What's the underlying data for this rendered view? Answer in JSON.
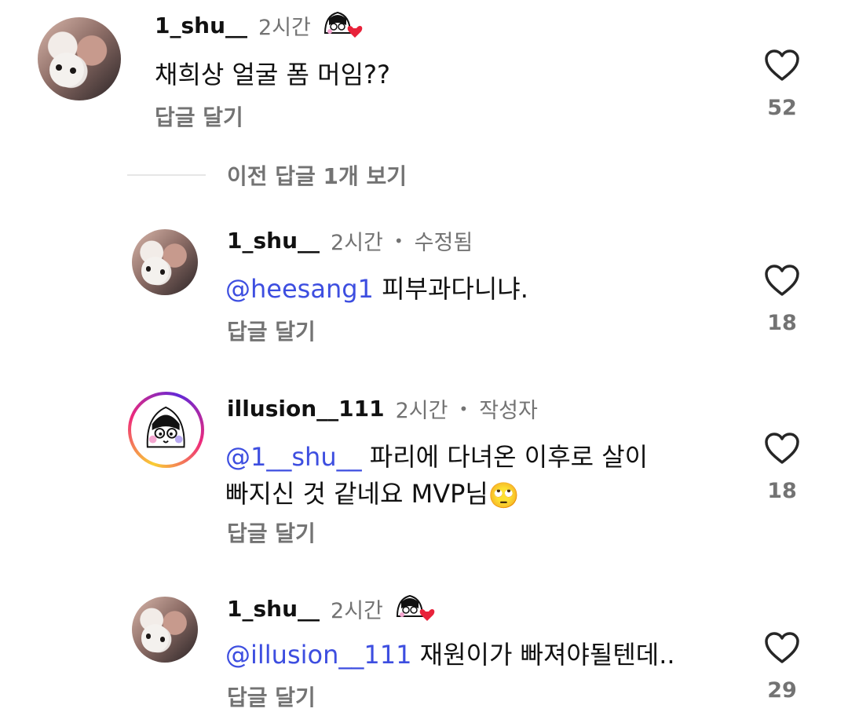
{
  "comments": [
    {
      "username": "1_shu__",
      "time": "2시간",
      "text": "채희상 얼굴 폼 머임??",
      "reply_label": "답글 달기",
      "likes": "52"
    }
  ],
  "view_previous": "이전 답글 1개 보기",
  "replies": [
    {
      "username": "1_shu__",
      "time": "2시간",
      "separator": "•",
      "tag": "수정됨",
      "mention": "@heesang1",
      "text": " 피부과다니냐.",
      "reply_label": "답글 달기",
      "likes": "18"
    },
    {
      "username": "illusion__111",
      "time": "2시간",
      "separator": "•",
      "tag": "작성자",
      "mention": "@1__shu__",
      "text_line1": " 파리에 다녀온 이후로 살이",
      "text_line2": "빠지신 것 같네요 MVP님",
      "emoji": "🙄",
      "reply_label": "답글 달기",
      "likes": "18"
    },
    {
      "username": "1_shu__",
      "time": "2시간",
      "mention": "@illusion__111",
      "text": " 재원이가 빠져야될텐데..",
      "reply_label": "답글 달기",
      "likes": "29"
    }
  ],
  "colors": {
    "mention": "#3d4ee0",
    "secondary_text": "#737373",
    "heart_stroke": "#262626",
    "sticker_heart": "#e8223a"
  }
}
